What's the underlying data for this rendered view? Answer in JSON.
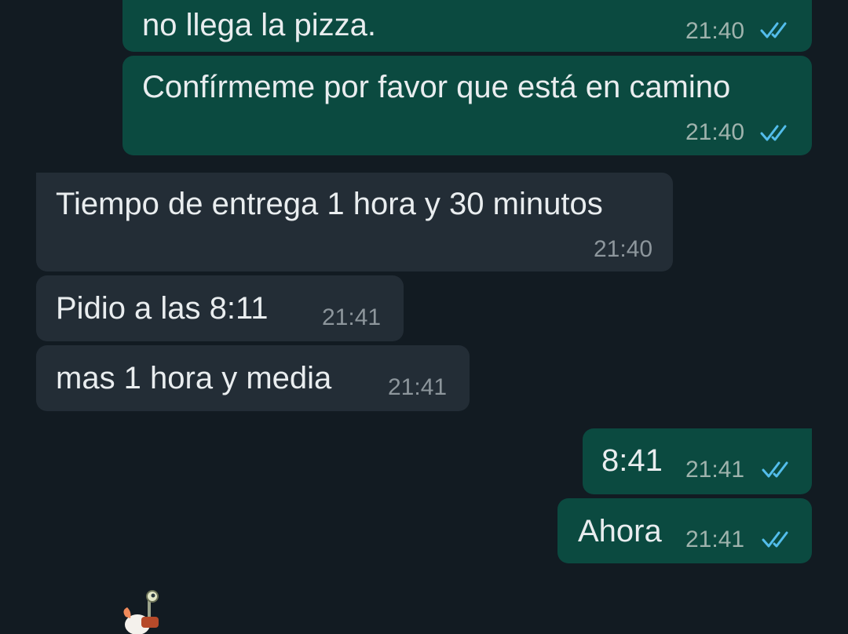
{
  "chat": {
    "messages": [
      {
        "dir": "out",
        "text": "no llega la pizza.",
        "time": "21:40",
        "status": "read"
      },
      {
        "dir": "out",
        "text": "Confírmeme por favor que está en camino",
        "time": "21:40",
        "status": "read"
      },
      {
        "dir": "in",
        "text": "Tiempo de entrega 1 hora y 30 minutos",
        "time": "21:40"
      },
      {
        "dir": "in",
        "text": "Pidio a las 8:11",
        "time": "21:41"
      },
      {
        "dir": "in",
        "text": "mas 1 hora y media",
        "time": "21:41"
      },
      {
        "dir": "out",
        "text": "8:41",
        "time": "21:41",
        "status": "read"
      },
      {
        "dir": "out",
        "text": "Ahora",
        "time": "21:41",
        "status": "read"
      }
    ]
  },
  "colors": {
    "background": "#121b22",
    "outgoing_bubble": "#0b4a40",
    "incoming_bubble": "#232d36",
    "read_ticks": "#53bdeb"
  },
  "icons": {
    "read_receipt": "double-check-icon",
    "sticker": "sticker-icon"
  }
}
